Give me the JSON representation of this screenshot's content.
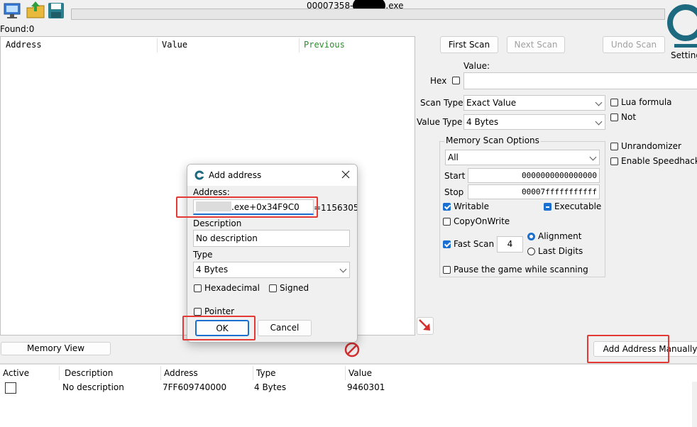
{
  "window": {
    "title_prefix": "00007358-",
    "title_suffix": ".exe",
    "found_label": "Found:",
    "found_count": "0",
    "settings_label": "Setting"
  },
  "results_list": {
    "columns": [
      "Address",
      "Value",
      "Previous"
    ]
  },
  "scan": {
    "first_scan": "First Scan",
    "next_scan": "Next Scan",
    "undo_scan": "Undo Scan",
    "value_label": "Value:",
    "hex_label": "Hex",
    "scan_type_label": "Scan Type",
    "scan_type_value": "Exact Value",
    "value_type_label": "Value Type",
    "value_type_value": "4 Bytes",
    "lua_formula": "Lua formula",
    "not_label": "Not",
    "unrandomizer": "Unrandomizer",
    "enable_speedhack": "Enable Speedhack"
  },
  "memory_options": {
    "title": "Memory Scan Options",
    "region": "All",
    "start_label": "Start",
    "start_value": "0000000000000000",
    "stop_label": "Stop",
    "stop_value": "00007fffffffffff",
    "writable": "Writable",
    "executable": "Executable",
    "copy_on_write": "CopyOnWrite",
    "fast_scan": "Fast Scan",
    "fast_scan_value": "4",
    "alignment": "Alignment",
    "last_digits": "Last Digits",
    "pause_game": "Pause the game while scanning"
  },
  "dialog": {
    "title": "Add address",
    "address_label": "Address:",
    "address_value": ".exe+0x34F9C0",
    "address_result": "=1156305",
    "description_label": "Description",
    "description_value": "No description",
    "type_label": "Type",
    "type_value": "4 Bytes",
    "hexadecimal": "Hexadecimal",
    "signed": "Signed",
    "pointer": "Pointer",
    "ok": "OK",
    "cancel": "Cancel"
  },
  "bottom": {
    "memory_view": "Memory View",
    "add_manually": "Add Address Manually"
  },
  "cheat_table": {
    "columns": [
      "Active",
      "Description",
      "Address",
      "Type",
      "Value"
    ],
    "rows": [
      {
        "description": "No description",
        "address": "7FF609740000",
        "type": "4 Bytes",
        "value": "9460301"
      }
    ]
  },
  "colors": {
    "highlight_red": "#e53935",
    "accent_blue": "#1a6fd0",
    "previous_green": "#2e8b2e"
  }
}
